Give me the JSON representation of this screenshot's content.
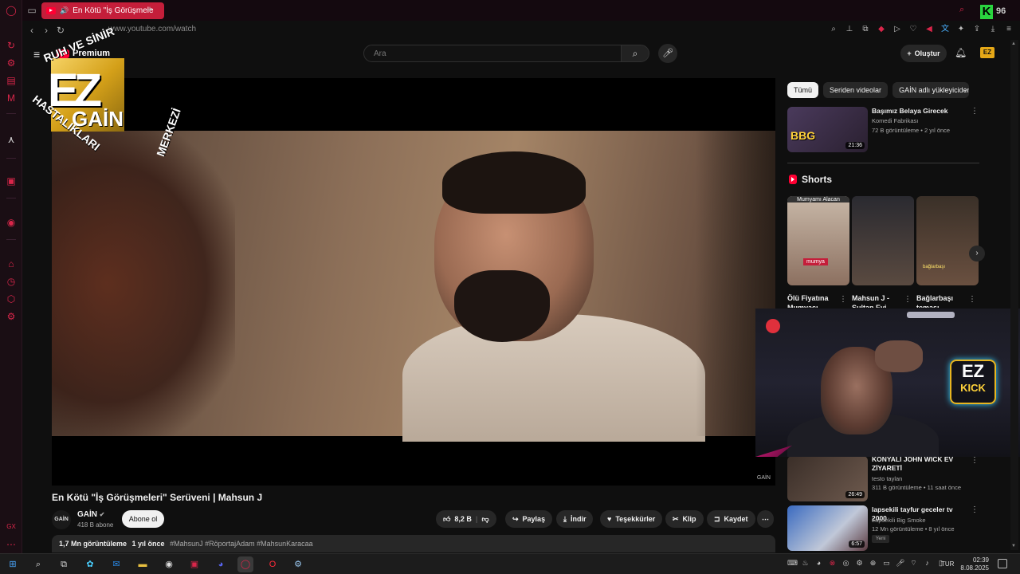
{
  "browser": {
    "tab_title": "En Kötü \"İş Görüşmele",
    "url": "www.youtube.com/watch",
    "new_tab_label": "+"
  },
  "youtube": {
    "logo_text": "Premium",
    "search_placeholder": "Ara",
    "create_label": "Oluştur",
    "avatar_text": "EZ"
  },
  "overlay": {
    "logo_top_arc": "RUH VE SİNİR",
    "logo_side_arc": "HASTALIKLARI",
    "logo_right_arc": "MERKEZİ",
    "logo_main": "EZ",
    "logo_sub": "GAİN",
    "kick_ez": "EZ",
    "kick_text": "KICK",
    "corner_k": "K",
    "corner_num": "96"
  },
  "video": {
    "watermark": "GAİN",
    "title": "En Kötü \"İş Görüşmeleri\" Serüveni | Mahsun J",
    "channel_avatar": "GAİN",
    "channel_name": "GAİN",
    "subscribers": "418 B abone",
    "subscribe_label": "Abone ol",
    "likes": "8,2 B",
    "share_label": "Paylaş",
    "download_label": "İndir",
    "thanks_label": "Teşekkürler",
    "clip_label": "Klip",
    "save_label": "Kaydet",
    "views": "1,7 Mn görüntüleme",
    "age": "1 yıl önce",
    "tags": "#MahsunJ #RöportajAdam #MahsunKaracaa"
  },
  "chips": [
    "Tümü",
    "Seriden videolar",
    "GAİN adlı yükleyiciden"
  ],
  "recommendations": [
    {
      "title": "Başımız Belaya Girecek",
      "channel": "Komedi Fabrikası",
      "meta": "72 B görüntüleme • 2 yıl önce",
      "duration": "21:36",
      "thumb_text": "BBG"
    },
    {
      "title": "KONYALI JOHN WICK EV ZİYARETİ",
      "channel": "testo taylan",
      "meta": "311 B görüntüleme • 11 saat önce",
      "duration": "26:49"
    },
    {
      "title": "lapsekili tayfur geceler tv 2000",
      "channel": "Lapsekili Big Smoke",
      "meta": "12 Mn görüntüleme • 8 yıl önce",
      "duration": "6:57",
      "badge": "Yeni"
    }
  ],
  "shorts": {
    "heading": "Shorts",
    "items": [
      {
        "caption": "Mumyamı Alacan",
        "title": "Ölü Fiyatına Mumyacı",
        "label": "mumya"
      },
      {
        "caption": "",
        "title": "Mahsun J - Sultan Evi",
        "label": ""
      },
      {
        "caption": "",
        "title": "Bağlarbaşı teması",
        "label": "bağlarbaşı"
      }
    ]
  },
  "taskbar": {
    "lang": "TUR",
    "time": "02:39",
    "date": "8.08.2025"
  },
  "colors": {
    "opera_red": "#c41e3a",
    "yt_red": "#ff0033",
    "kick_green": "#2ad33f",
    "gold": "#d4a019"
  }
}
